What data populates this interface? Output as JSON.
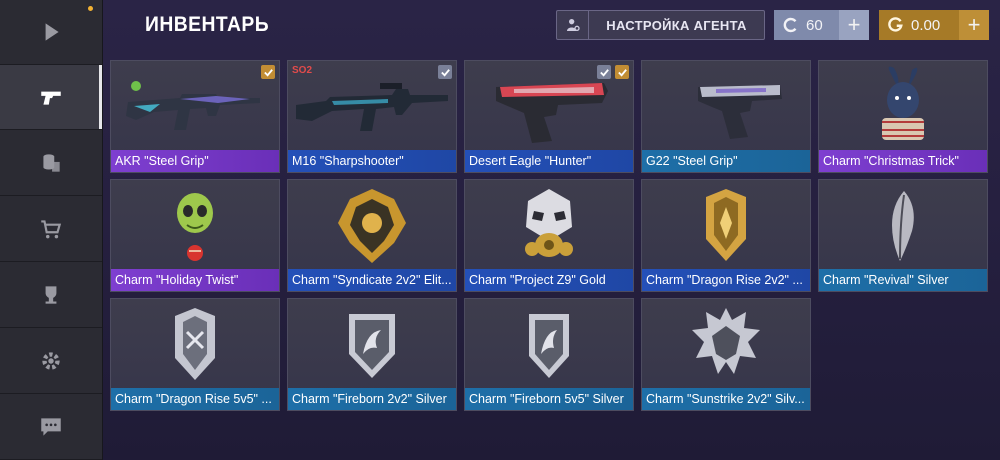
{
  "header": {
    "title": "ИНВЕНТАРЬ",
    "agent_button_label": "НАСТРОЙКА АГЕНТА",
    "silver_balance": "60",
    "gold_balance": "0.00"
  },
  "sidebar": {
    "items": [
      {
        "icon": "play-icon",
        "active": false
      },
      {
        "icon": "pistol-icon",
        "active": true
      },
      {
        "icon": "coins-icon",
        "active": false
      },
      {
        "icon": "cart-icon",
        "active": false
      },
      {
        "icon": "trophy-icon",
        "active": false
      },
      {
        "icon": "gear-icon",
        "active": false
      },
      {
        "icon": "chat-icon",
        "active": false
      }
    ]
  },
  "inventory": {
    "items": [
      {
        "name": "AKR \"Steel Grip\"",
        "rarity": "purple",
        "art": "rifle-icon"
      },
      {
        "name": "M16 \"Sharpshooter\"",
        "rarity": "blue",
        "art": "rifle-icon"
      },
      {
        "name": "Desert Eagle \"Hunter\"",
        "rarity": "blue",
        "art": "pistol-icon"
      },
      {
        "name": "G22 \"Steel Grip\"",
        "rarity": "teal",
        "art": "pistol-icon"
      },
      {
        "name": "Charm \"Christmas Trick\"",
        "rarity": "purple",
        "art": "bunny-charm-icon"
      },
      {
        "name": "Charm \"Holiday Twist\"",
        "rarity": "purple",
        "art": "alien-charm-icon"
      },
      {
        "name": "Charm \"Syndicate 2v2\" Elit...",
        "rarity": "blue",
        "art": "gold-emblem-icon"
      },
      {
        "name": "Charm \"Project Z9\" Gold",
        "rarity": "blue",
        "art": "gasmask-charm-icon"
      },
      {
        "name": "Charm \"Dragon Rise 2v2\" ...",
        "rarity": "blue",
        "art": "gold-shield-icon"
      },
      {
        "name": "Charm \"Revival\" Silver",
        "rarity": "teal",
        "art": "feather-charm-icon"
      },
      {
        "name": "Charm \"Dragon Rise 5v5\" ...",
        "rarity": "teal",
        "art": "silver-shield-icon"
      },
      {
        "name": "Charm \"Fireborn 2v2\" Silver",
        "rarity": "teal",
        "art": "dragon-shield-icon"
      },
      {
        "name": "Charm \"Fireborn 5v5\" Silver",
        "rarity": "teal",
        "art": "dragon-shield-icon"
      },
      {
        "name": "Charm \"Sunstrike 2v2\" Silv...",
        "rarity": "teal",
        "art": "spiked-shield-icon"
      }
    ]
  },
  "colors": {
    "purple": "#7e3fd0",
    "blue": "#2450b8",
    "teal": "#1e6fa8",
    "gold_currency": "#b4852f",
    "silver_currency": "#8f9ab9"
  }
}
